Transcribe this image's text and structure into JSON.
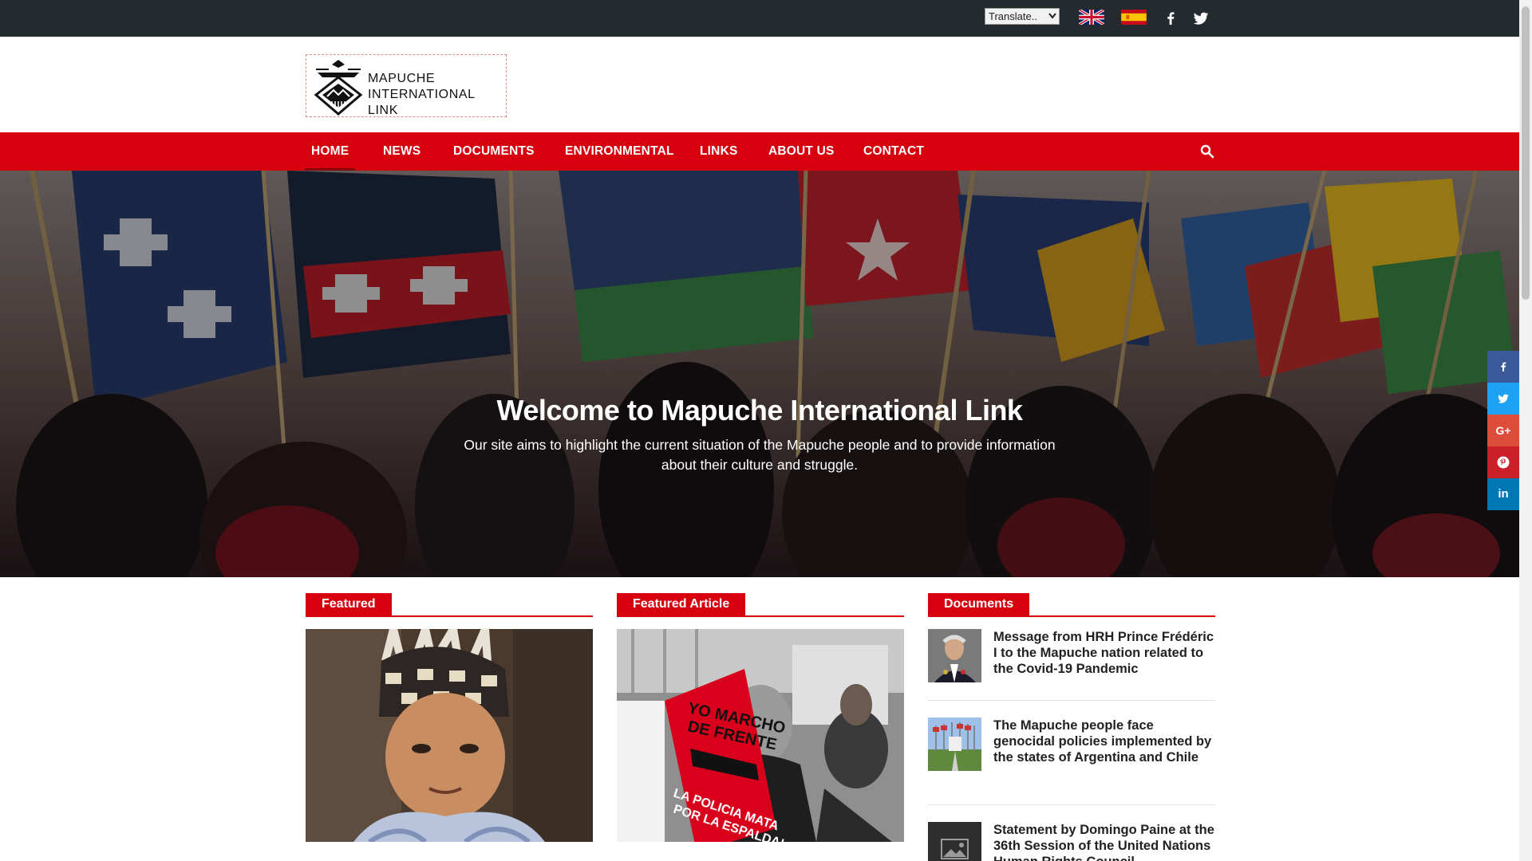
{
  "topbar": {
    "translate_label": "Translate..",
    "social": [
      {
        "icon": "facebook-icon",
        "glyph": "f"
      },
      {
        "icon": "twitter-icon",
        "glyph": "t"
      }
    ]
  },
  "header": {
    "logo_line1": "MAPUCHE",
    "logo_line2": "INTERNATIONAL LINK"
  },
  "nav": {
    "items": [
      "HOME",
      "NEWS",
      "DOCUMENTS",
      "ENVIRONMENTAL",
      "LINKS",
      "ABOUT US",
      "CONTACT"
    ],
    "active": "HOME"
  },
  "hero": {
    "title": "Welcome to Mapuche International Link",
    "subtitle": "Our site aims to highlight the current situation of the Mapuche people and to provide information about their culture and struggle."
  },
  "share": [
    {
      "icon": "facebook-icon",
      "glyph": "f",
      "color": "#3b5998"
    },
    {
      "icon": "twitter-icon",
      "glyph": "t",
      "color": "#1da1f2"
    },
    {
      "icon": "google-plus-icon",
      "glyph": "G+",
      "color": "#dd4b39"
    },
    {
      "icon": "pinterest-icon",
      "glyph": "P",
      "color": "#cb2027"
    },
    {
      "icon": "linkedin-icon",
      "glyph": "in",
      "color": "#0077b5"
    }
  ],
  "sections": {
    "featured": "Featured",
    "featured_article": "Featured Article",
    "documents": "Documents"
  },
  "documents": [
    {
      "title": "Message from HRH Prince Frédéric I to the Mapuche nation related to the Covid-19 Pandemic"
    },
    {
      "title": "The Mapuche people face genocidal policies implemented by the states of Argentina and Chile"
    },
    {
      "title": "Statement by Domingo Paine at the 36th Session of the United Nations Human Rights Council"
    }
  ],
  "featured_article_sign": {
    "line1": "YO MARCHO",
    "line2": "DE FRENTE",
    "line3": "LA POLICIA MATA",
    "line4": "POR LA ESPALDA!"
  },
  "colors": {
    "topbar": "#242b2e",
    "accent": "#d7000f"
  }
}
